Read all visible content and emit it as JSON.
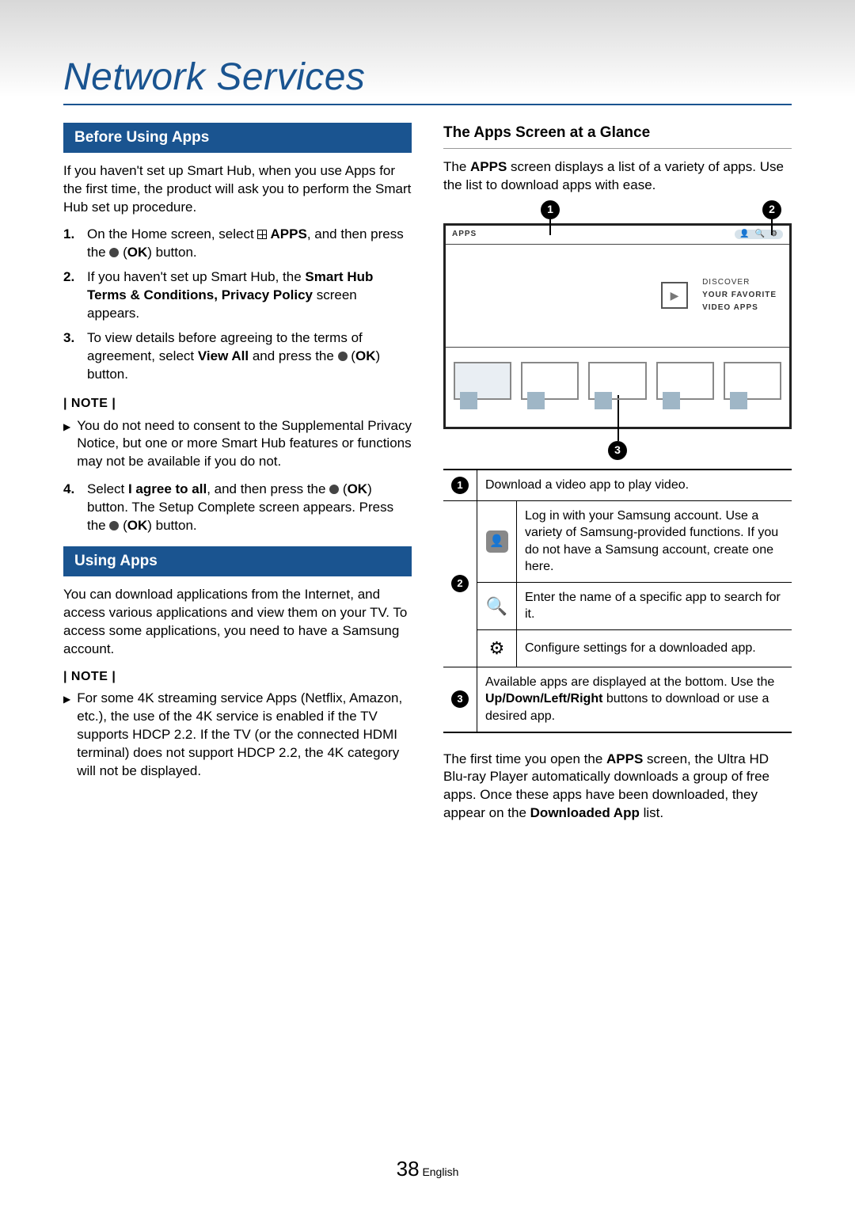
{
  "title": "Network Services",
  "left": {
    "before_hdr": "Before Using Apps",
    "before_para": "If you haven't set up Smart Hub, when you use Apps for the first time, the product will ask you to perform the Smart Hub set up procedure.",
    "step1_a": "On the Home screen, select ",
    "step1_b": " APPS",
    "step1_c": ", and then press the ",
    "step1_d": " (OK",
    "step1_e": ") button.",
    "step2_a": "If you haven't set up Smart Hub, the ",
    "step2_b": "Smart Hub Terms & Conditions, Privacy Policy",
    "step2_c": " screen appears.",
    "step3_a": "To view details before agreeing to the terms of agreement, select ",
    "step3_b": "View All",
    "step3_c": " and press the ",
    "step3_d": " (OK",
    "step3_e": ") button.",
    "note_hdr": "| NOTE |",
    "note1": "You do not need to consent to the Supplemental Privacy Notice, but one or more Smart Hub features or functions may not be available if you do not.",
    "step4_a": "Select ",
    "step4_b": "I agree to all",
    "step4_c": ", and then press the ",
    "step4_d": " (OK",
    "step4_e": ") button. The Setup Complete screen appears. Press the ",
    "step4_f": " (OK",
    "step4_g": ") button.",
    "using_hdr": "Using Apps",
    "using_para": "You can download applications from the Internet, and access various applications and view them on your TV. To access some applications, you need to have a Samsung account.",
    "note2": "For some 4K streaming service Apps (Netflix, Amazon, etc.), the use of the 4K service is enabled if the TV supports HDCP 2.2. If the TV (or the connected HDMI terminal) does not support HDCP 2.2, the 4K category will not be displayed."
  },
  "right": {
    "glance_hdr": "The Apps Screen at a Glance",
    "glance_a": "The ",
    "glance_b": "APPS",
    "glance_c": " screen displays a list of a variety of apps. Use the list to download apps with ease.",
    "apps_label": "APPS",
    "discover1": "DISCOVER",
    "discover2": "YOUR FAVORITE",
    "discover3": "VIDEO APPS",
    "legend1": "Download a video app to play video.",
    "legend2a": "Log in with your Samsung account. Use a variety of Samsung-provided functions. If you do not have a Samsung account, create one here.",
    "legend2b": "Enter the name of a specific app to search for it.",
    "legend2c": "Configure settings for a downloaded app.",
    "legend3_a": "Available apps are displayed at the bottom. Use the ",
    "legend3_b": "Up/Down/Left/Right",
    "legend3_c": " buttons to download or use a desired app.",
    "closing_a": "The first time you open the ",
    "closing_b": "APPS",
    "closing_c": " screen, the Ultra HD Blu-ray Player automatically downloads a group of free apps. Once these apps have been downloaded, they appear on the ",
    "closing_d": "Downloaded App",
    "closing_e": " list."
  },
  "footer": {
    "page": "38",
    "lang": "English"
  }
}
